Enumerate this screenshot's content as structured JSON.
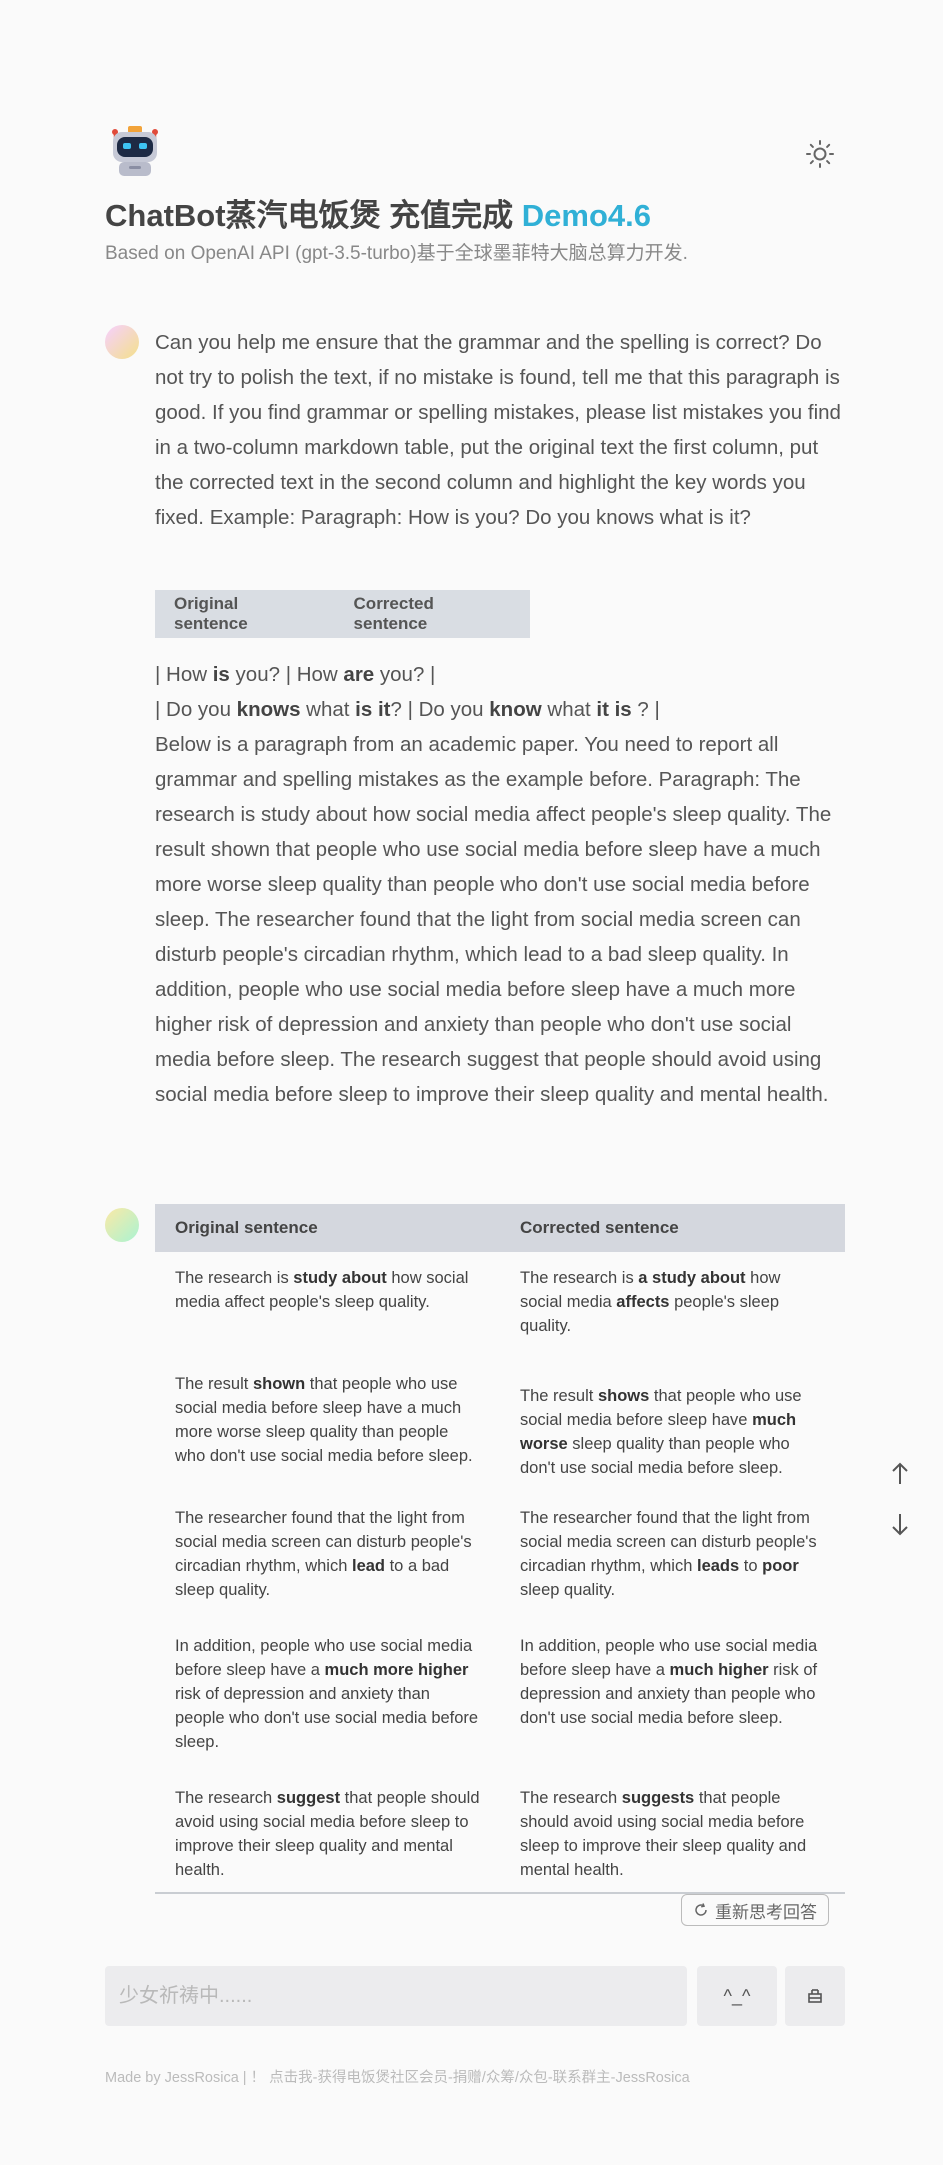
{
  "header": {
    "title_main": "ChatBot蒸汽电饭煲 充值完成",
    "title_version": "Demo4.6",
    "subtitle": "Based on OpenAI API (gpt-3.5-turbo)基于全球墨菲特大脑总算力开发."
  },
  "user_message": {
    "part1": "Can you help me ensure that the grammar and the spelling is correct? Do not try to polish the text, if no mistake is found, tell me that this paragraph is good. If you find grammar or spelling mistakes, please list mistakes you find in a two-column markdown table, put the original text the first column, put the corrected text in the second column and highlight the key words you fixed. Example: Paragraph: How is you? Do you knows what is it?",
    "mini_table_headers": [
      "Original sentence",
      "Corrected sentence"
    ],
    "line1": {
      "a": " | How ",
      "b": "is",
      "c": " you? | How ",
      "d": "are",
      "e": " you? |"
    },
    "line2": {
      "a": " | Do you ",
      "b": "knows",
      "c": " what ",
      "d": "is it",
      "e": "? | Do you ",
      "f": "know",
      "g": " what ",
      "h": "it is",
      "i": " ? |"
    },
    "part2": " Below is a paragraph from an academic paper. You need to report all grammar and spelling mistakes as the example before. Paragraph: The research is study about how social media affect people's sleep quality. The result shown that people who use social media before sleep have a much more worse sleep quality than people who don't use social media before sleep. The researcher found that the light from social media screen can disturb people's circadian rhythm, which lead to a bad sleep quality. In addition, people who use social media before sleep have a much more higher risk of depression and anxiety than people who don't use social media before sleep. The research suggest that people should avoid using social media before sleep to improve their sleep quality and mental health."
  },
  "bot_table": {
    "headers": [
      "Original sentence",
      "Corrected sentence"
    ],
    "rows": [
      {
        "orig": {
          "a": "The research is ",
          "b": "study about",
          "c": " how social media affect people's sleep quality."
        },
        "corr": {
          "a": "The research is ",
          "b": "a study about",
          "c": " how social media ",
          "d": "affects",
          "e": " people's sleep quality."
        }
      },
      {
        "orig": {
          "a": "The result ",
          "b": "shown",
          "c": " that people who use social media before sleep have a much more worse sleep quality than people who don't use social media before sleep."
        },
        "corr": {
          "a": "The result ",
          "b": "shows",
          "c": " that people who use social media before sleep have ",
          "d": "much worse",
          "e": " sleep quality than people who don't use social media before sleep."
        }
      },
      {
        "orig": {
          "a": "The researcher found that the light from social media screen can disturb people's circadian rhythm, which ",
          "b": "lead",
          "c": " to a bad sleep quality."
        },
        "corr": {
          "a": "The researcher found that the light from social media screen can disturb people's circadian rhythm, which ",
          "b": "leads",
          "c": " to ",
          "d": "poor",
          "e": " sleep quality."
        }
      },
      {
        "orig": {
          "a": "In addition, people who use social media before sleep have a ",
          "b": "much more higher",
          "c": " risk of depression and anxiety than people who don't use social media before sleep."
        },
        "corr": {
          "a": "In addition, people who use social media before sleep have a ",
          "b": "much higher",
          "c": " risk of depression and anxiety than people who don't use social media before sleep."
        }
      },
      {
        "orig": {
          "a": "The research ",
          "b": "suggest",
          "c": " that people should avoid using social media before sleep to improve their sleep quality and mental health."
        },
        "corr": {
          "a": "The research ",
          "b": "suggests",
          "c": " that people should avoid using social media before sleep to improve their sleep quality and mental health."
        }
      }
    ]
  },
  "regenerate_label": "重新思考回答",
  "input": {
    "placeholder": "少女祈祷中......"
  },
  "emoticon_button": "^_^",
  "footer": "Made by  JessRosica  |  ！ 点击我-获得电饭煲社区会员-捐赠/众筹/众包-联系群主-JessRosica",
  "icons": {
    "logo": "robot-logo-icon",
    "theme": "sun-icon",
    "regenerate": "refresh-icon",
    "scroll_up": "arrow-up-icon",
    "scroll_down": "arrow-down-icon",
    "clear": "clear-icon"
  }
}
